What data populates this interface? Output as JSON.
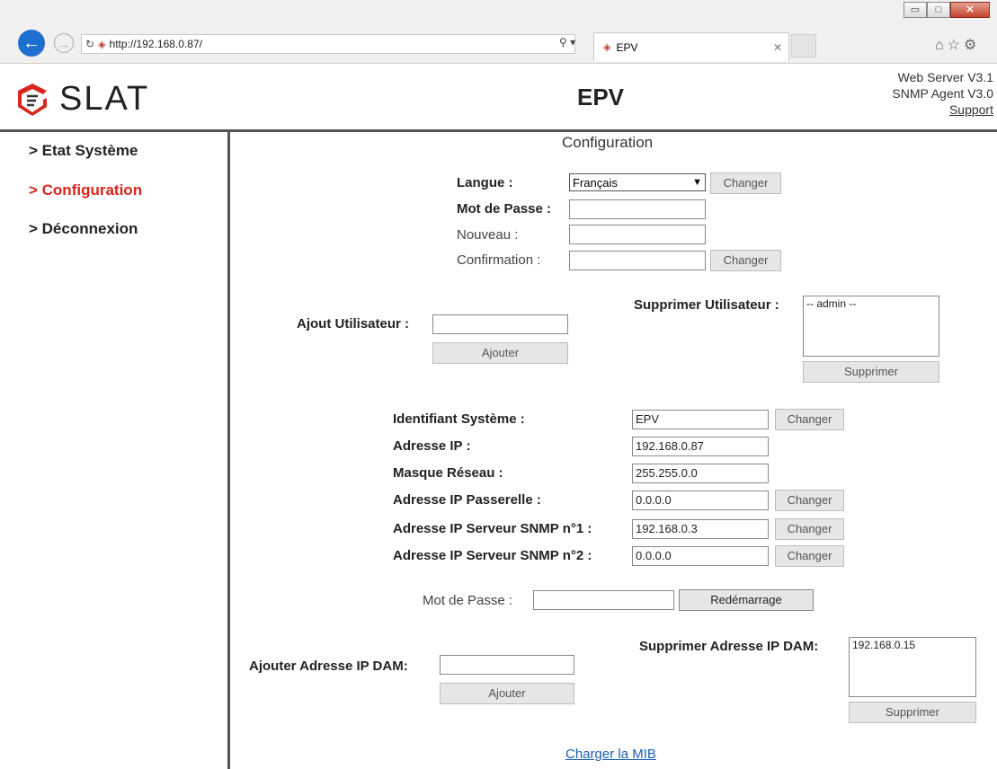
{
  "browser": {
    "url": "http://192.168.0.87/",
    "tab_title": "EPV",
    "window_controls": {
      "minimize": "▭",
      "maximize": "□",
      "close": "✕"
    }
  },
  "header": {
    "logo_text": "SLAT",
    "title": "EPV",
    "web_server_version": "Web Server V3.1",
    "snmp_agent_version": "SNMP Agent V3.0",
    "support_link": "Support"
  },
  "sidebar": {
    "items": [
      {
        "label": "> Etat Système",
        "active": false
      },
      {
        "label": "> Configuration",
        "active": true
      },
      {
        "label": "> Déconnexion",
        "active": false
      }
    ]
  },
  "main": {
    "page_title": "Configuration",
    "langue_label": "Langue :",
    "langue_value": "Français",
    "langue_button": "Changer",
    "password_label": "Mot de Passe :",
    "new_label": "Nouveau :",
    "confirm_label": "Confirmation :",
    "password_button": "Changer",
    "add_user_label": "Ajout Utilisateur :",
    "add_user_button": "Ajouter",
    "delete_user_label": "Supprimer Utilisateur :",
    "delete_user_list": [
      "-- admin --"
    ],
    "delete_user_button": "Supprimer",
    "system_id_label": "Identifiant Système :",
    "system_id_value": "EPV",
    "ip_label": "Adresse IP :",
    "ip_value": "192.168.0.87",
    "mask_label": "Masque Réseau :",
    "mask_value": "255.255.0.0",
    "gateway_label": "Adresse IP Passerelle :",
    "gateway_value": "0.0.0.0",
    "snmp1_label": "Adresse IP Serveur SNMP n°1 :",
    "snmp1_value": "192.168.0.3",
    "snmp2_label": "Adresse IP Serveur SNMP n°2 :",
    "snmp2_value": "0.0.0.0",
    "change_button": "Changer",
    "reboot_password_label": "Mot de Passe :",
    "reboot_button": "Redémarrage",
    "add_dam_label": "Ajouter Adresse IP DAM:",
    "add_dam_button": "Ajouter",
    "delete_dam_label": "Supprimer Adresse IP DAM:",
    "delete_dam_list": [
      "192.168.0.15"
    ],
    "delete_dam_button": "Supprimer",
    "mib_link": "Charger la MIB"
  },
  "colors": {
    "accent_red": "#d9261c",
    "link_blue": "#1a5fb4"
  }
}
